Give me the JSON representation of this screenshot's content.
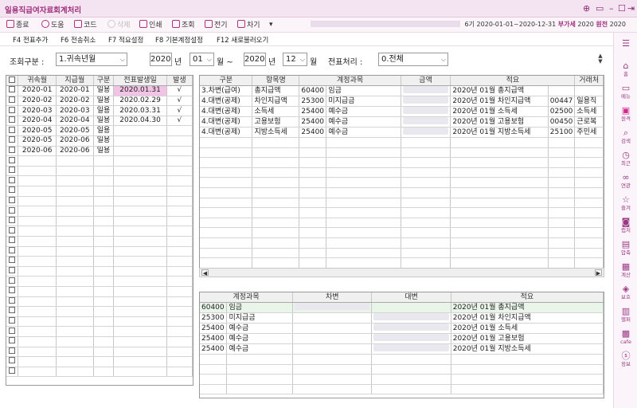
{
  "window": {
    "title": "일용직급여자료회계처리",
    "controls": [
      "⊕",
      "▭",
      "–",
      "☐",
      "⇥"
    ]
  },
  "toolbar": {
    "close": "종료",
    "help": "도움",
    "code": "코드",
    "delete": "삭제",
    "print": "인쇄",
    "search": "조회",
    "prev": "전기",
    "next": "차기",
    "more": "▾",
    "period_prefix": "6기",
    "period": "2020-01-01~2020-12-31",
    "tax_label": "부가세",
    "tax_value": "2020",
    "income_label": "원천",
    "income_value": "2020"
  },
  "fkeys": [
    "F4 전표추가",
    "F6 전송취소",
    "F7 적요설정",
    "F8 기본계정설정",
    "F12 새로불러오기"
  ],
  "filter": {
    "label": "조회구분 :",
    "type_value": "1.귀속년월",
    "from_year": "2020",
    "year_unit": "년",
    "from_month": "01",
    "month_unit_tilde": "월 ~",
    "to_year": "2020",
    "year_unit2": "년",
    "to_month": "12",
    "month_unit": "월",
    "voucher_label": "전표처리 :",
    "voucher_value": "0.전체"
  },
  "left_grid": {
    "headers": [
      "",
      "귀속월",
      "지급월",
      "구분",
      "전표발생일",
      "발생"
    ],
    "rows": [
      {
        "a": "2020-01",
        "p": "2020-01",
        "t": "일용",
        "d": "2020.01.31",
        "g": "√"
      },
      {
        "a": "2020-02",
        "p": "2020-02",
        "t": "일용",
        "d": "2020.02.29",
        "g": "√"
      },
      {
        "a": "2020-03",
        "p": "2020-03",
        "t": "일용",
        "d": "2020.03.31",
        "g": "√"
      },
      {
        "a": "2020-04",
        "p": "2020-04",
        "t": "일용",
        "d": "2020.04.30",
        "g": "√"
      },
      {
        "a": "2020-05",
        "p": "2020-05",
        "t": "일용",
        "d": "",
        "g": ""
      },
      {
        "a": "2020-05",
        "p": "2020-06",
        "t": "일용",
        "d": "",
        "g": ""
      },
      {
        "a": "2020-06",
        "p": "2020-06",
        "t": "일용",
        "d": "",
        "g": ""
      }
    ]
  },
  "right_grid": {
    "headers": [
      "구분",
      "항목명",
      "계정과목",
      "",
      "금액",
      "적요",
      "",
      "거래처"
    ],
    "rows": [
      {
        "k": "3.차변(급여)",
        "n": "총지급액",
        "cd": "60400",
        "nm": "임금",
        "s": "2020년 01월 총지급액",
        "pc": "",
        "pn": ""
      },
      {
        "k": "4.대변(공제)",
        "n": "차인지급액",
        "cd": "25300",
        "nm": "미지급금",
        "s": "2020년 01월 차인지급액",
        "pc": "00447",
        "pn": "일용직"
      },
      {
        "k": "4.대변(공제)",
        "n": "소득세",
        "cd": "25400",
        "nm": "예수금",
        "s": "2020년 01월 소득세",
        "pc": "02500",
        "pn": "소득세"
      },
      {
        "k": "4.대변(공제)",
        "n": "고용보험",
        "cd": "25400",
        "nm": "예수금",
        "s": "2020년 01월 고용보험",
        "pc": "00450",
        "pn": "근로복"
      },
      {
        "k": "4.대변(공제)",
        "n": "지방소득세",
        "cd": "25400",
        "nm": "예수금",
        "s": "2020년 01월 지방소득세",
        "pc": "25100",
        "pn": "주민세"
      }
    ]
  },
  "bottom_grid": {
    "headers": [
      "계정과목",
      "",
      "차변",
      "대변",
      "적요"
    ],
    "rows": [
      {
        "cd": "60400",
        "nm": "임금",
        "s": "2020년 01월 총지급액"
      },
      {
        "cd": "25300",
        "nm": "미지급금",
        "s": "2020년 01월 차인지급액"
      },
      {
        "cd": "25400",
        "nm": "예수금",
        "s": "2020년 01월 소득세"
      },
      {
        "cd": "25400",
        "nm": "예수금",
        "s": "2020년 01월 고용보험"
      },
      {
        "cd": "25400",
        "nm": "예수금",
        "s": "2020년 01월 지방소득세"
      }
    ]
  },
  "sidebar": [
    {
      "icon": "menu-icon",
      "glyph": "☰",
      "label": ""
    },
    {
      "icon": "home-icon",
      "glyph": "⌂",
      "label": "홈"
    },
    {
      "icon": "menu-list-icon",
      "glyph": "▭",
      "label": "메뉴"
    },
    {
      "icon": "book-icon",
      "glyph": "▣",
      "label": "원격"
    },
    {
      "icon": "search-icon",
      "glyph": "⌕",
      "label": "검색"
    },
    {
      "icon": "recent-icon",
      "glyph": "◷",
      "label": "최근"
    },
    {
      "icon": "link-icon",
      "glyph": "∞",
      "label": "연관"
    },
    {
      "icon": "star-icon",
      "glyph": "☆",
      "label": "즐겨"
    },
    {
      "icon": "camera-icon",
      "glyph": "◙",
      "label": "캡처"
    },
    {
      "icon": "compress-icon",
      "glyph": "▤",
      "label": "압축"
    },
    {
      "icon": "calculator-icon",
      "glyph": "▦",
      "label": "계산"
    },
    {
      "icon": "shield-icon",
      "glyph": "◈",
      "label": "보호"
    },
    {
      "icon": "printer-icon",
      "glyph": "▥",
      "label": "헬퍼"
    },
    {
      "icon": "cafe-icon",
      "glyph": "▩",
      "label": "cafe"
    },
    {
      "icon": "info-icon",
      "glyph": "ⓢ",
      "label": "정보"
    }
  ]
}
